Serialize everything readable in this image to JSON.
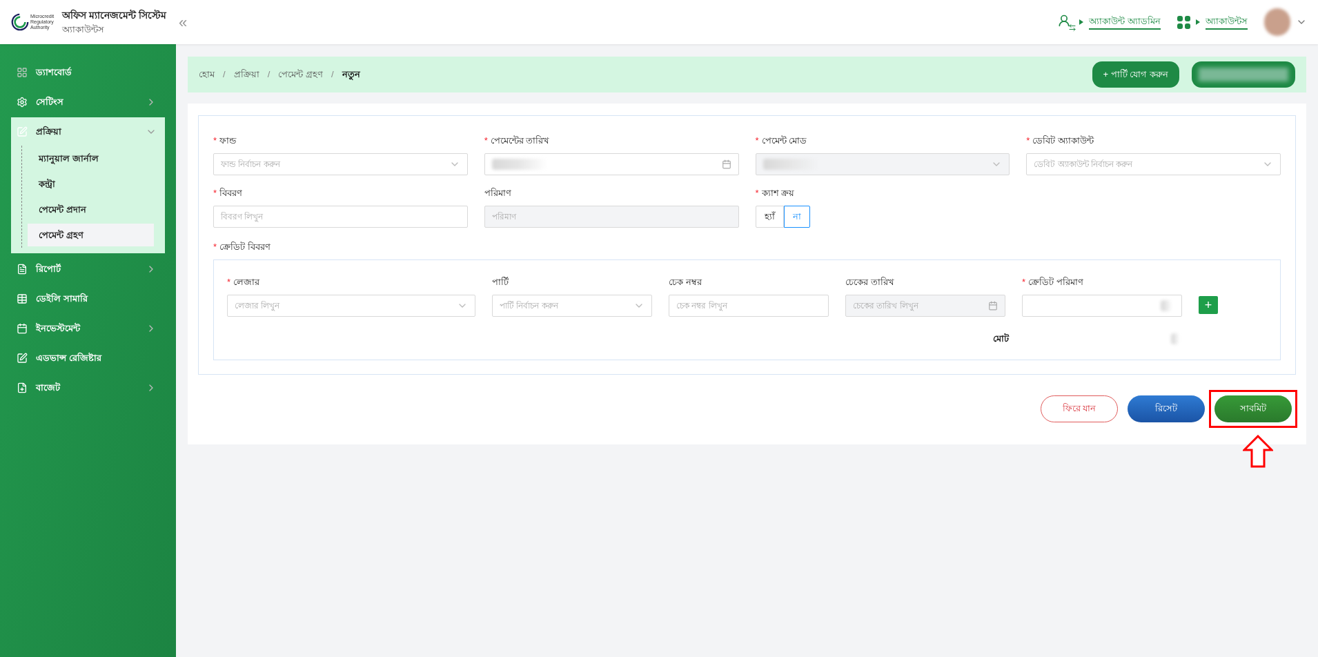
{
  "header": {
    "logo_text": [
      "Microcredit",
      "Regulatory",
      "Authority"
    ],
    "title": "অফিস ম্যানেজমেন্ট সিস্টেম",
    "subtitle": "অ্যাকাউন্টস",
    "collapse_glyph": "«",
    "links": [
      {
        "kind": "user",
        "label": "অ্যাকাউন্ট অ্যাডমিন"
      },
      {
        "kind": "apps",
        "label": "অ্যাকাউন্টস"
      }
    ]
  },
  "sidebar": {
    "items": [
      {
        "label": "ড্যাশবোর্ড"
      },
      {
        "label": "সেটিংস",
        "expanded": false
      },
      {
        "label": "প্রক্রিয়া",
        "expanded": true,
        "children": [
          {
            "label": "ম্যানুয়াল জার্নাল",
            "selected": false
          },
          {
            "label": "কন্ট্রা",
            "selected": false
          },
          {
            "label": "পেমেন্ট প্রদান",
            "selected": false
          },
          {
            "label": "পেমেন্ট গ্রহণ",
            "selected": true
          }
        ]
      },
      {
        "label": "রিপোর্ট",
        "expanded": false
      },
      {
        "label": "ডেইলি সামারি"
      },
      {
        "label": "ইনভেস্টমেন্ট",
        "expanded": false
      },
      {
        "label": "এডভান্স রেজিষ্টার"
      },
      {
        "label": "বাজেট",
        "expanded": false
      }
    ]
  },
  "breadcrumb": [
    {
      "label": "হোম"
    },
    {
      "separator": "/",
      "label": "প্রক্রিয়া"
    },
    {
      "separator": "/",
      "label": "পেমেন্ট গ্রহণ"
    },
    {
      "separator": "/",
      "label": "নতুন"
    }
  ],
  "top_button": "+ পার্টি যোগ করুন",
  "form": {
    "rows": [
      [
        {
          "kind": "select",
          "label": "ফান্ড",
          "required_mark": "*",
          "placeholder": "ফান্ড নির্বাচন করুন",
          "disabled": false
        },
        {
          "kind": "date",
          "label": "পেমেন্টের তারিখ",
          "required_mark": "*",
          "redacted": true,
          "disabled": false
        },
        {
          "kind": "select",
          "label": "পেমেন্ট মোড",
          "required_mark": "*",
          "redacted": true,
          "disabled": true
        },
        {
          "kind": "select",
          "label": "ডেবিট অ্যাকাউন্ট",
          "required_mark": "*",
          "placeholder": "ডেবিট অ্যাকাউন্ট নির্বাচন করুন",
          "disabled": false
        }
      ],
      [
        {
          "kind": "text",
          "label": "বিবরণ",
          "required_mark": "*",
          "placeholder": "বিবরণ লিখুন",
          "disabled": false
        },
        {
          "kind": "text",
          "label": "পরিমাণ",
          "placeholder": "পরিমাণ",
          "disabled": true
        },
        {
          "kind": "toggle",
          "label": "ক্যাশ ক্রয়",
          "required_mark": "*",
          "options": [
            {
              "label": "হ্যাঁ",
              "selected": false
            },
            {
              "label": "না",
              "selected": true
            }
          ]
        }
      ]
    ],
    "credit": {
      "label": "ক্রেডিট বিবরণ",
      "required_mark": "*",
      "fields": [
        {
          "kind": "select",
          "label": "লেজার",
          "required_mark": "*",
          "placeholder": "লেজার লিখুন",
          "disabled": false
        },
        {
          "kind": "select",
          "label": "পার্টি",
          "placeholder": "পার্টি নির্বাচন করুন",
          "disabled": false
        },
        {
          "kind": "text",
          "label": "চেক নম্বর",
          "placeholder": "চেক নম্বর লিখুন",
          "disabled": false
        },
        {
          "kind": "date",
          "label": "চেকের তারিখ",
          "placeholder": "চেকের তারিখ লিখুন",
          "disabled": true
        },
        {
          "kind": "amount",
          "label": "ক্রেডিট পরিমাণ",
          "required_mark": "*",
          "redacted": true,
          "disabled": false
        }
      ],
      "add_glyph": "+",
      "total_label": "মোট"
    }
  },
  "actions": [
    {
      "kind": "back",
      "label": "ফিরে যান",
      "highlighted": false
    },
    {
      "kind": "reset",
      "label": "রিসেট",
      "highlighted": false
    },
    {
      "kind": "submit",
      "label": "সাবমিট",
      "highlighted": true
    }
  ]
}
